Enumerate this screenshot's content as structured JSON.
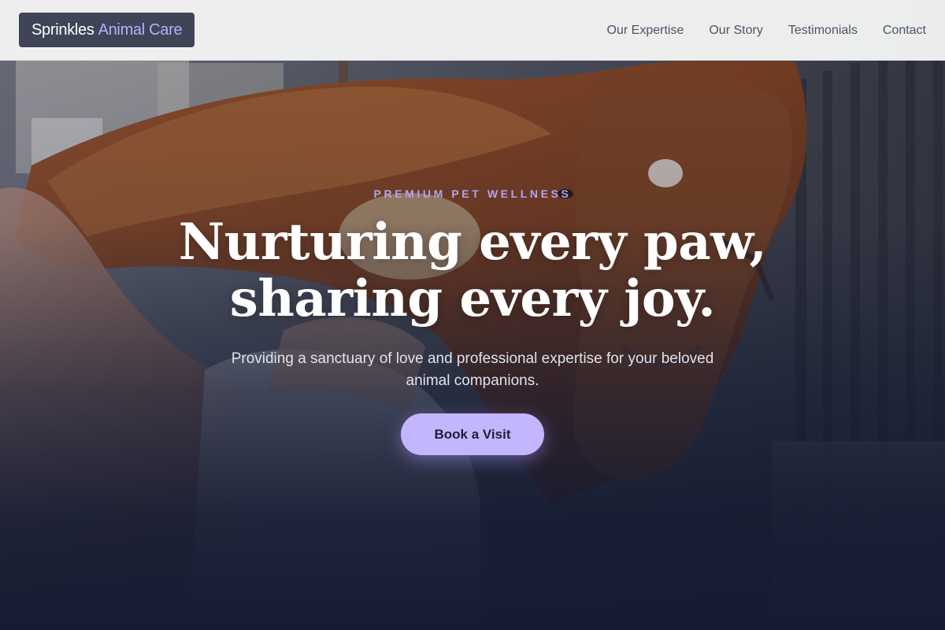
{
  "brand": {
    "name_primary": "Sprinkles",
    "name_accent": "Animal Care",
    "accent_color": "#b9adff"
  },
  "nav": {
    "items": [
      {
        "label": "Our Expertise"
      },
      {
        "label": "Our Story"
      },
      {
        "label": "Testimonials"
      },
      {
        "label": "Contact"
      }
    ]
  },
  "hero": {
    "eyebrow": "PREMIUM PET WELLNESS",
    "headline_line1": "Nurturing every paw,",
    "headline_line2": "sharing every joy.",
    "subtext": "Providing a sanctuary of love and professional expertise for your beloved animal companions.",
    "cta_label": "Book a Visit",
    "cta_color": "#c3b6ff",
    "background_image": "woman-hugging-horse-in-stable"
  }
}
